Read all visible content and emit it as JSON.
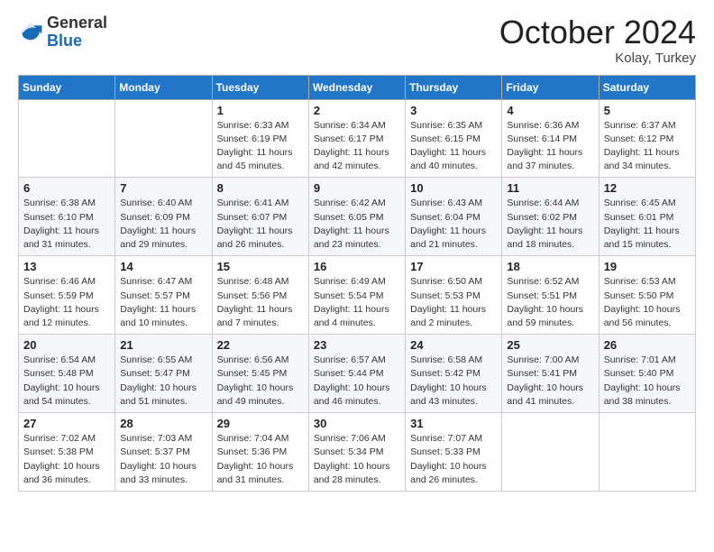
{
  "header": {
    "logo_general": "General",
    "logo_blue": "Blue",
    "month": "October 2024",
    "location": "Kolay, Turkey"
  },
  "days_of_week": [
    "Sunday",
    "Monday",
    "Tuesday",
    "Wednesday",
    "Thursday",
    "Friday",
    "Saturday"
  ],
  "weeks": [
    [
      {
        "day": "",
        "info": ""
      },
      {
        "day": "",
        "info": ""
      },
      {
        "day": "1",
        "info": "Sunrise: 6:33 AM\nSunset: 6:19 PM\nDaylight: 11 hours and 45 minutes."
      },
      {
        "day": "2",
        "info": "Sunrise: 6:34 AM\nSunset: 6:17 PM\nDaylight: 11 hours and 42 minutes."
      },
      {
        "day": "3",
        "info": "Sunrise: 6:35 AM\nSunset: 6:15 PM\nDaylight: 11 hours and 40 minutes."
      },
      {
        "day": "4",
        "info": "Sunrise: 6:36 AM\nSunset: 6:14 PM\nDaylight: 11 hours and 37 minutes."
      },
      {
        "day": "5",
        "info": "Sunrise: 6:37 AM\nSunset: 6:12 PM\nDaylight: 11 hours and 34 minutes."
      }
    ],
    [
      {
        "day": "6",
        "info": "Sunrise: 6:38 AM\nSunset: 6:10 PM\nDaylight: 11 hours and 31 minutes."
      },
      {
        "day": "7",
        "info": "Sunrise: 6:40 AM\nSunset: 6:09 PM\nDaylight: 11 hours and 29 minutes."
      },
      {
        "day": "8",
        "info": "Sunrise: 6:41 AM\nSunset: 6:07 PM\nDaylight: 11 hours and 26 minutes."
      },
      {
        "day": "9",
        "info": "Sunrise: 6:42 AM\nSunset: 6:05 PM\nDaylight: 11 hours and 23 minutes."
      },
      {
        "day": "10",
        "info": "Sunrise: 6:43 AM\nSunset: 6:04 PM\nDaylight: 11 hours and 21 minutes."
      },
      {
        "day": "11",
        "info": "Sunrise: 6:44 AM\nSunset: 6:02 PM\nDaylight: 11 hours and 18 minutes."
      },
      {
        "day": "12",
        "info": "Sunrise: 6:45 AM\nSunset: 6:01 PM\nDaylight: 11 hours and 15 minutes."
      }
    ],
    [
      {
        "day": "13",
        "info": "Sunrise: 6:46 AM\nSunset: 5:59 PM\nDaylight: 11 hours and 12 minutes."
      },
      {
        "day": "14",
        "info": "Sunrise: 6:47 AM\nSunset: 5:57 PM\nDaylight: 11 hours and 10 minutes."
      },
      {
        "day": "15",
        "info": "Sunrise: 6:48 AM\nSunset: 5:56 PM\nDaylight: 11 hours and 7 minutes."
      },
      {
        "day": "16",
        "info": "Sunrise: 6:49 AM\nSunset: 5:54 PM\nDaylight: 11 hours and 4 minutes."
      },
      {
        "day": "17",
        "info": "Sunrise: 6:50 AM\nSunset: 5:53 PM\nDaylight: 11 hours and 2 minutes."
      },
      {
        "day": "18",
        "info": "Sunrise: 6:52 AM\nSunset: 5:51 PM\nDaylight: 10 hours and 59 minutes."
      },
      {
        "day": "19",
        "info": "Sunrise: 6:53 AM\nSunset: 5:50 PM\nDaylight: 10 hours and 56 minutes."
      }
    ],
    [
      {
        "day": "20",
        "info": "Sunrise: 6:54 AM\nSunset: 5:48 PM\nDaylight: 10 hours and 54 minutes."
      },
      {
        "day": "21",
        "info": "Sunrise: 6:55 AM\nSunset: 5:47 PM\nDaylight: 10 hours and 51 minutes."
      },
      {
        "day": "22",
        "info": "Sunrise: 6:56 AM\nSunset: 5:45 PM\nDaylight: 10 hours and 49 minutes."
      },
      {
        "day": "23",
        "info": "Sunrise: 6:57 AM\nSunset: 5:44 PM\nDaylight: 10 hours and 46 minutes."
      },
      {
        "day": "24",
        "info": "Sunrise: 6:58 AM\nSunset: 5:42 PM\nDaylight: 10 hours and 43 minutes."
      },
      {
        "day": "25",
        "info": "Sunrise: 7:00 AM\nSunset: 5:41 PM\nDaylight: 10 hours and 41 minutes."
      },
      {
        "day": "26",
        "info": "Sunrise: 7:01 AM\nSunset: 5:40 PM\nDaylight: 10 hours and 38 minutes."
      }
    ],
    [
      {
        "day": "27",
        "info": "Sunrise: 7:02 AM\nSunset: 5:38 PM\nDaylight: 10 hours and 36 minutes."
      },
      {
        "day": "28",
        "info": "Sunrise: 7:03 AM\nSunset: 5:37 PM\nDaylight: 10 hours and 33 minutes."
      },
      {
        "day": "29",
        "info": "Sunrise: 7:04 AM\nSunset: 5:36 PM\nDaylight: 10 hours and 31 minutes."
      },
      {
        "day": "30",
        "info": "Sunrise: 7:06 AM\nSunset: 5:34 PM\nDaylight: 10 hours and 28 minutes."
      },
      {
        "day": "31",
        "info": "Sunrise: 7:07 AM\nSunset: 5:33 PM\nDaylight: 10 hours and 26 minutes."
      },
      {
        "day": "",
        "info": ""
      },
      {
        "day": "",
        "info": ""
      }
    ]
  ]
}
